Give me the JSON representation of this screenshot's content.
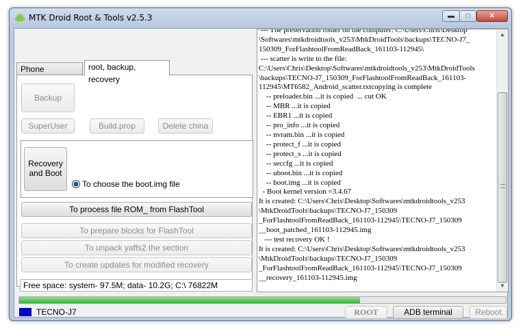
{
  "window": {
    "title": "MTK Droid Root & Tools v2.5.3",
    "minimize_glyph": "▬",
    "maximize_glyph": "□",
    "close_glyph": "✕"
  },
  "tabs": [
    {
      "label": "Phone information",
      "active": false
    },
    {
      "label": "root, backup, recovery",
      "active": true
    }
  ],
  "panel": {
    "backup": "Backup",
    "superuser": "SuperUser",
    "build_prop": "Build.prop",
    "delete_china": "Delete china",
    "recovery_and_boot": "Recovery and Boot",
    "radio_label": "To choose the boot.img file",
    "process_rom": "To process file ROM_ from FlashTool",
    "prepare_blocks": "To prepare blocks for FlashTool",
    "unpack_yaffs2": "To unpack yaffs2 the section",
    "create_updates": "To create updates for modified recovery"
  },
  "free_space": "Free space: system- 97.5M; data- 10.2G;  C:\\ 76822M",
  "log": [
    " --- The preservation folder on the computer: C:\\Users\\Chris\\Desktop",
    "\\Softwares\\mtkdroidtools_v253\\MtkDroidTools\\backups\\TECNO-J7_",
    "150309_ForFlashtoolFromReadBack_161103-112945\\",
    " --- scatter is write to the file:",
    "C:\\Users\\Chris\\Desktop\\Softwares\\mtkdroidtools_v253\\MtkDroidTools",
    "\\backups\\TECNO-J7_150309_ForFlashtoolFromReadBack_161103-",
    "112945\\MT6582_Android_scatter.txtcopying is complete",
    "    -- preloader.bin ...it is copied  ... cut OK",
    "    -- MBR ...it is copied",
    "    -- EBR1 ...it is copied",
    "    -- pro_info ...it is copied",
    "    -- nvram.bin ...it is copied",
    "    -- protect_f ...it is copied",
    "    -- protect_s ...it is copied",
    "    -- seccfg ...it is copied",
    "    -- uboot.bin ...it is copied",
    "    -- boot.img ...it is copied",
    "  - Boot kernel version =3.4.67",
    "It is created: C:\\Users\\Chris\\Desktop\\Softwares\\mtkdroidtools_v253",
    "\\MtkDroidTools\\backups\\TECNO-J7_150309",
    "_ForFlashtoolFromReadBack_161103-112945\\TECNO-J7_150309",
    "__boot_patched_161103-112945.img",
    "   --- test recovery OK !",
    "It is created: C:\\Users\\Chris\\Desktop\\Softwares\\mtkdroidtools_v253",
    "\\MtkDroidTools\\backups\\TECNO-J7_150309",
    "_ForFlashtoolFromReadBack_161103-112945\\TECNO-J7_150309",
    "__recovery_161103-112945.img"
  ],
  "scrollbar": {
    "up_glyph": "▲",
    "down_glyph": "▼"
  },
  "progress_fraction": 0.7,
  "status": {
    "device_color": "#0000e0",
    "device_name": "TECNO-J7",
    "root": "ROOT",
    "adb_terminal": "ADB terminal",
    "reboot": "Reboot"
  }
}
